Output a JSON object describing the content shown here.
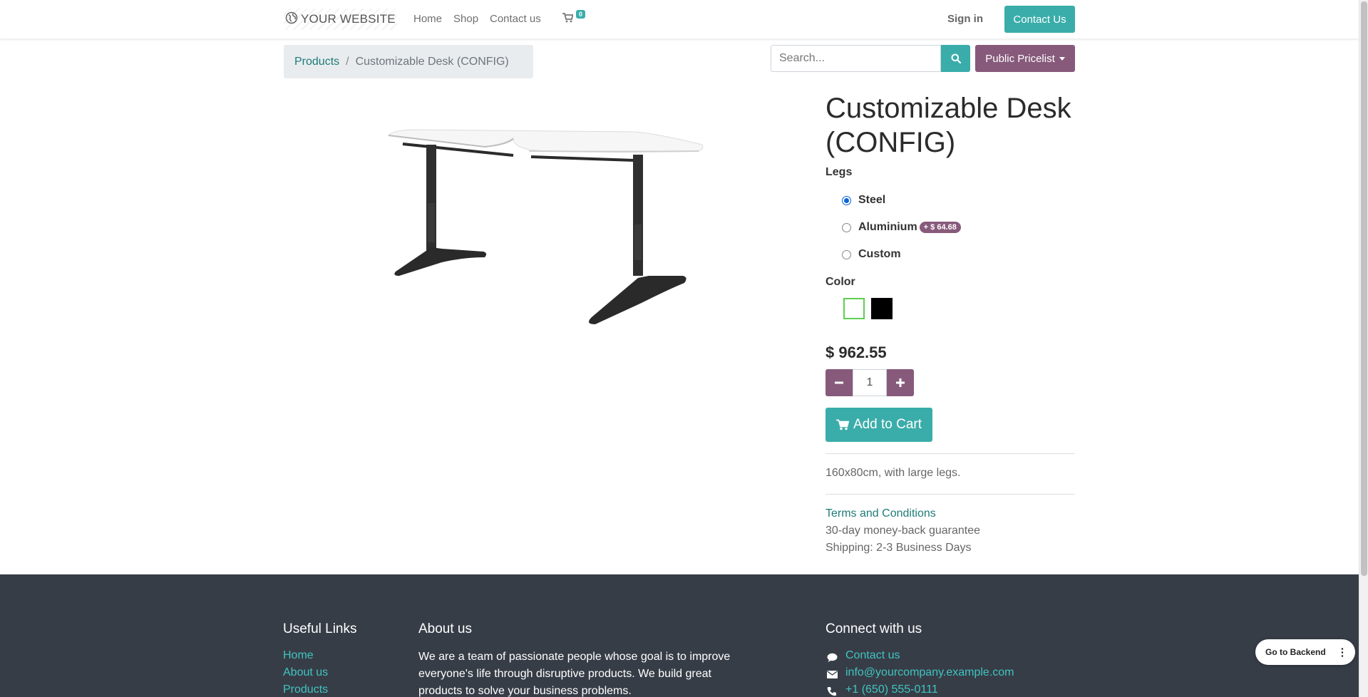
{
  "header": {
    "brand": "YOUR WEBSITE",
    "nav": [
      "Home",
      "Shop",
      "Contact us"
    ],
    "cart_count": "0",
    "signin": "Sign in",
    "contact_button": "Contact Us"
  },
  "breadcrumb": {
    "parent": "Products",
    "separator": "/",
    "current": "Customizable Desk (CONFIG)"
  },
  "search": {
    "placeholder": "Search...",
    "pricelist": "Public Pricelist"
  },
  "product": {
    "title": "Customizable Desk (CONFIG)",
    "legs_label": "Legs",
    "legs_options": [
      {
        "label": "Steel",
        "selected": true
      },
      {
        "label": "Aluminium",
        "extra": "+ $ 64.68",
        "selected": false
      },
      {
        "label": "Custom",
        "selected": false
      }
    ],
    "color_label": "Color",
    "colors": [
      {
        "name": "white",
        "hex": "#ffffff",
        "selected": true
      },
      {
        "name": "black",
        "hex": "#000000",
        "selected": false
      }
    ],
    "price": "$ 962.55",
    "quantity": "1",
    "add_to_cart": "Add to Cart",
    "description": "160x80cm, with large legs.",
    "terms": "Terms and Conditions",
    "guarantee": "30-day money-back guarantee",
    "shipping": "Shipping: 2-3 Business Days"
  },
  "footer": {
    "useful_links_title": "Useful Links",
    "useful_links": [
      "Home",
      "About us",
      "Products"
    ],
    "about_title": "About us",
    "about_text": "We are a team of passionate people whose goal is to improve everyone's life through disruptive products. We build great products to solve your business problems.",
    "connect_title": "Connect with us",
    "connect": [
      {
        "icon": "comment-icon",
        "label": "Contact us"
      },
      {
        "icon": "envelope-icon",
        "label": "info@yourcompany.example.com"
      },
      {
        "icon": "phone-icon",
        "label": "+1 (650) 555-0111"
      }
    ]
  },
  "backend": {
    "label": "Go to Backend",
    "menu": "⋮"
  },
  "colors": {
    "primary": "#3aadaa",
    "secondary": "#875a7b",
    "footer_bg": "#373d47",
    "link": "#1e7b78"
  }
}
